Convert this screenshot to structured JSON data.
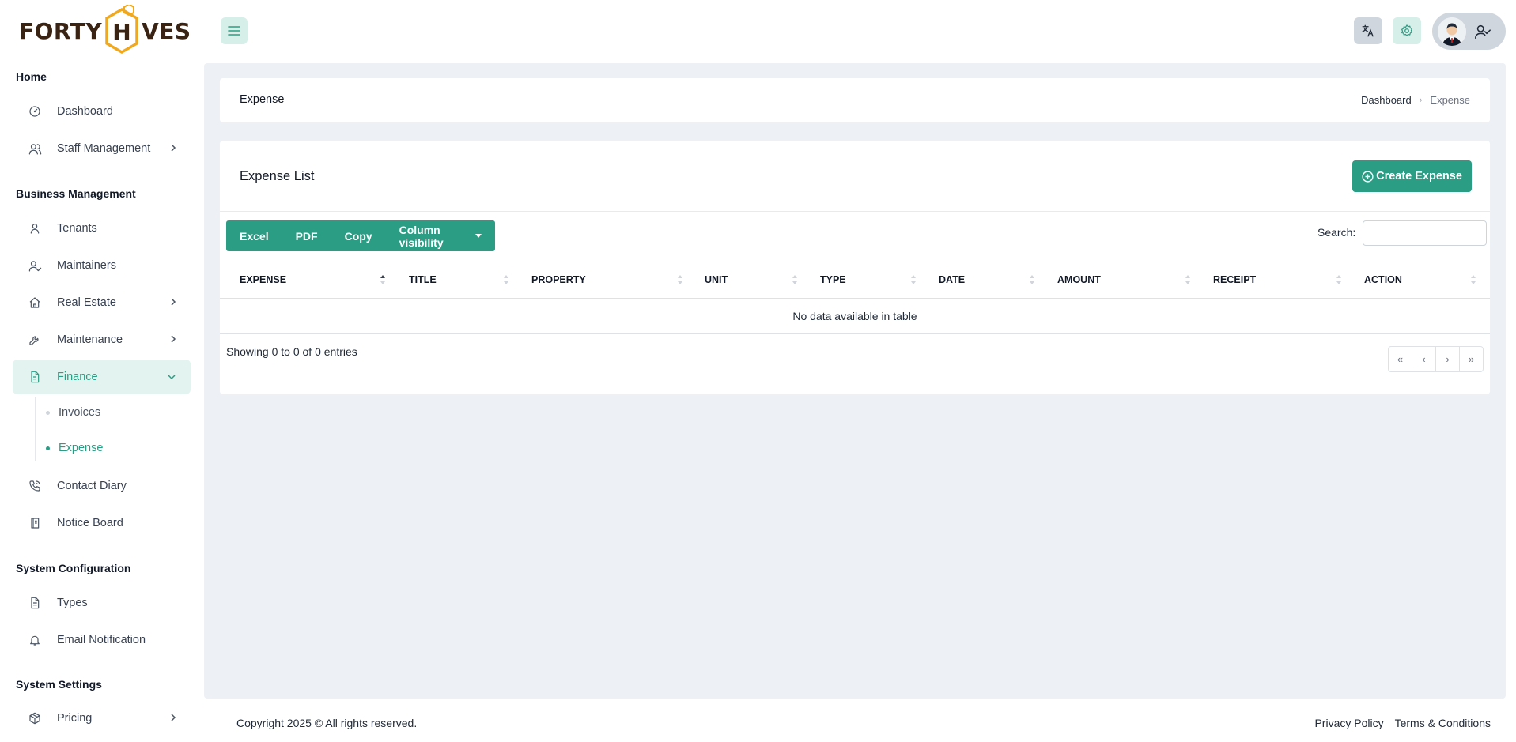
{
  "brand": {
    "logo_left": "FORTY",
    "logo_h": "H",
    "logo_right": "VES",
    "accent_color": "#2a9d84",
    "logo_hex_color": "#f0a81e"
  },
  "sidebar": {
    "sections": [
      {
        "title": "Home"
      },
      {
        "title": "Business Management"
      },
      {
        "title": "System Configuration"
      },
      {
        "title": "System Settings"
      }
    ],
    "items": [
      {
        "label": "Dashboard",
        "icon": "gauge-icon"
      },
      {
        "label": "Staff Management",
        "icon": "users-icon",
        "has_children": true
      },
      {
        "label": "Tenants",
        "icon": "user-icon"
      },
      {
        "label": "Maintainers",
        "icon": "user-check-icon"
      },
      {
        "label": "Real Estate",
        "icon": "home-icon",
        "has_children": true
      },
      {
        "label": "Maintenance",
        "icon": "wrench-icon",
        "has_children": true
      },
      {
        "label": "Finance",
        "icon": "file-invoice-icon",
        "has_children": true,
        "active": true
      },
      {
        "label": "Contact Diary",
        "icon": "phone-icon"
      },
      {
        "label": "Notice Board",
        "icon": "notebook-icon"
      },
      {
        "label": "Types",
        "icon": "document-icon"
      },
      {
        "label": "Email Notification",
        "icon": "bell-icon"
      },
      {
        "label": "Pricing",
        "icon": "package-icon",
        "has_children": true
      }
    ],
    "finance_children": [
      {
        "label": "Invoices",
        "active": false
      },
      {
        "label": "Expense",
        "active": true
      }
    ]
  },
  "topbar": {
    "menu_icon": "hamburger-icon",
    "translate_icon": "translate-icon",
    "settings_icon": "gear-icon",
    "profile_icon": "user-check-icon"
  },
  "page_header": {
    "title": "Expense",
    "breadcrumb": [
      {
        "label": "Dashboard"
      },
      {
        "label": "Expense"
      }
    ]
  },
  "expense_list": {
    "title": "Expense List",
    "create_button": "Create Expense",
    "export_buttons": [
      "Excel",
      "PDF",
      "Copy",
      "Column visibility"
    ],
    "search_label": "Search:",
    "search_value": "",
    "columns": [
      "EXPENSE",
      "TITLE",
      "PROPERTY",
      "UNIT",
      "TYPE",
      "DATE",
      "AMOUNT",
      "RECEIPT",
      "ACTION"
    ],
    "sorted_column": "EXPENSE",
    "sort_direction": "ascending",
    "empty_message": "No data available in table",
    "info": "Showing 0 to 0 of 0 entries",
    "pagination": [
      "«",
      "‹",
      "›",
      "»"
    ]
  },
  "footer": {
    "copyright": "Copyright 2025 © All rights reserved.",
    "links": [
      "Privacy Policy",
      "Terms & Conditions"
    ]
  }
}
